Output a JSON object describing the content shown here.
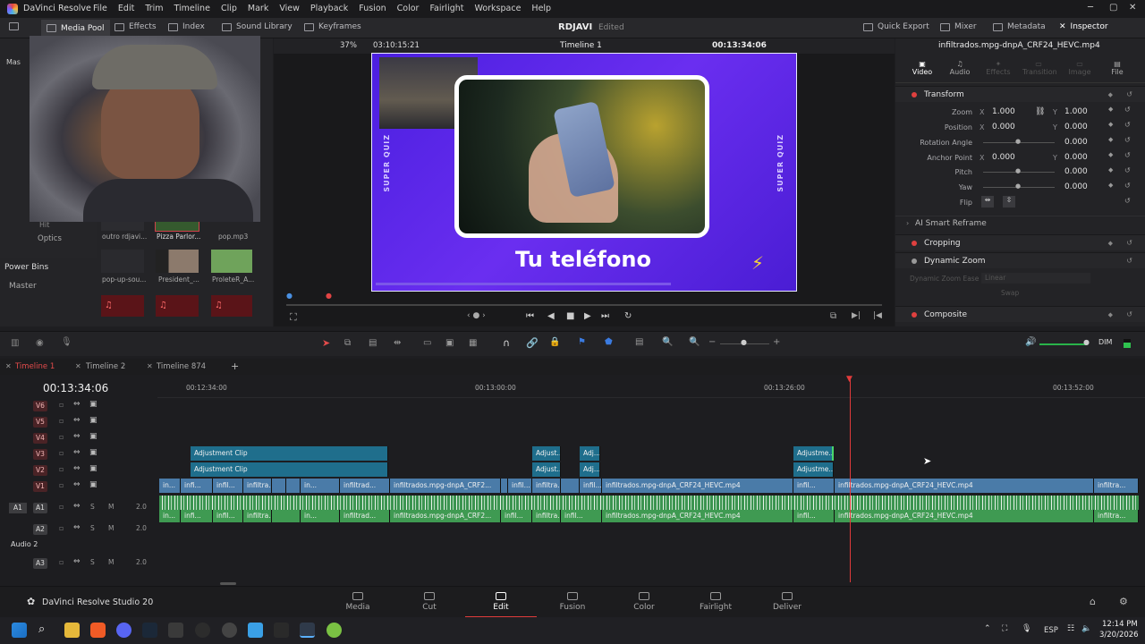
{
  "app": {
    "title": "DaVinci Resolve",
    "menus": [
      "File",
      "Edit",
      "Trim",
      "Timeline",
      "Clip",
      "Mark",
      "View",
      "Playback",
      "Fusion",
      "Color",
      "Fairlight",
      "Workspace",
      "Help"
    ]
  },
  "toolbar": {
    "media_pool": "Media Pool",
    "effects": "Effects",
    "index": "Index",
    "sound_library": "Sound Library",
    "keyframes": "Keyframes",
    "project": "RDJAVI",
    "status": "Edited",
    "quick_export": "Quick Export",
    "mixer": "Mixer",
    "metadata": "Metadata",
    "inspector": "Inspector"
  },
  "viewer": {
    "zoom": "37%",
    "source_tc": "03:10:15:21",
    "timeline_name": "Timeline 1",
    "timecode": "00:13:34:06",
    "overlay_title": "Tu teléfono",
    "side_text": "SUPER QUIZ"
  },
  "left_panel": {
    "master": "Mas",
    "optics": "Optics",
    "power_bins": "Power Bins",
    "power_master": "Master",
    "hit": "Hit",
    "clips": [
      "outro rdjavi...",
      "Pizza Parlor...",
      "pop.mp3",
      "pop-up-sou...",
      "President_...",
      "ProleteR_A..."
    ]
  },
  "inspector": {
    "clip_name": "infiltrados.mpg-dnpA_CRF24_HEVC.mp4",
    "tabs": [
      "Video",
      "Audio",
      "Effects",
      "Transition",
      "Image",
      "File"
    ],
    "transform": "Transform",
    "zoom_label": "Zoom",
    "zoom_x": "1.000",
    "zoom_y": "1.000",
    "position_label": "Position",
    "position_x": "0.000",
    "position_y": "0.000",
    "rotation_label": "Rotation Angle",
    "rotation": "0.000",
    "anchor_label": "Anchor Point",
    "anchor_x": "0.000",
    "anchor_y": "0.000",
    "pitch_label": "Pitch",
    "pitch": "0.000",
    "yaw_label": "Yaw",
    "yaw": "0.000",
    "flip_label": "Flip",
    "ai_reframe": "AI Smart Reframe",
    "cropping": "Cropping",
    "dynamic_zoom": "Dynamic Zoom",
    "dz_ease": "Dynamic Zoom Ease",
    "dz_value": "Linear",
    "swap": "Swap",
    "composite": "Composite",
    "x": "X",
    "y": "Y"
  },
  "timeline": {
    "tabs": [
      "Timeline 1",
      "Timeline 2",
      "Timeline 874"
    ],
    "timecode": "00:13:34:06",
    "dim": "DIM",
    "ruler": [
      "00:12:34:00",
      "00:13:00:00",
      "00:13:26:00",
      "00:13:52:00"
    ],
    "tracks_video": [
      "V6",
      "V5",
      "V4",
      "V3",
      "V2",
      "V1"
    ],
    "tracks_audio": [
      "A1",
      "A2",
      "A3"
    ],
    "a1_badge": "A1",
    "audio2": "Audio 2",
    "levels": [
      "2.0",
      "2.0",
      "2.0"
    ],
    "clip_adjustment": "Adjustment Clip",
    "clip_adjust_short": "Adjust...",
    "clip_adj": "Adj...",
    "clip_adjustme": "Adjustme...",
    "clip_main": "infiltrados.mpg-dnpA_CRF2...",
    "clip_full": "infiltrados.mpg-dnpA_CRF24_HEVC.mp4",
    "clip_short": "infiltrad...",
    "clip_infilt": "infiltra...",
    "clip_infil": "infil...",
    "clip_in": "in...",
    "clip_infi": "infi...",
    "solo": "S",
    "mute": "M"
  },
  "pages": {
    "brand": "DaVinci Resolve Studio 20",
    "items": [
      "Media",
      "Cut",
      "Edit",
      "Fusion",
      "Color",
      "Fairlight",
      "Deliver"
    ],
    "active": "Edit"
  },
  "taskbar": {
    "lang": "ESP",
    "time": "12:14 PM",
    "date": "3/20/2026"
  }
}
